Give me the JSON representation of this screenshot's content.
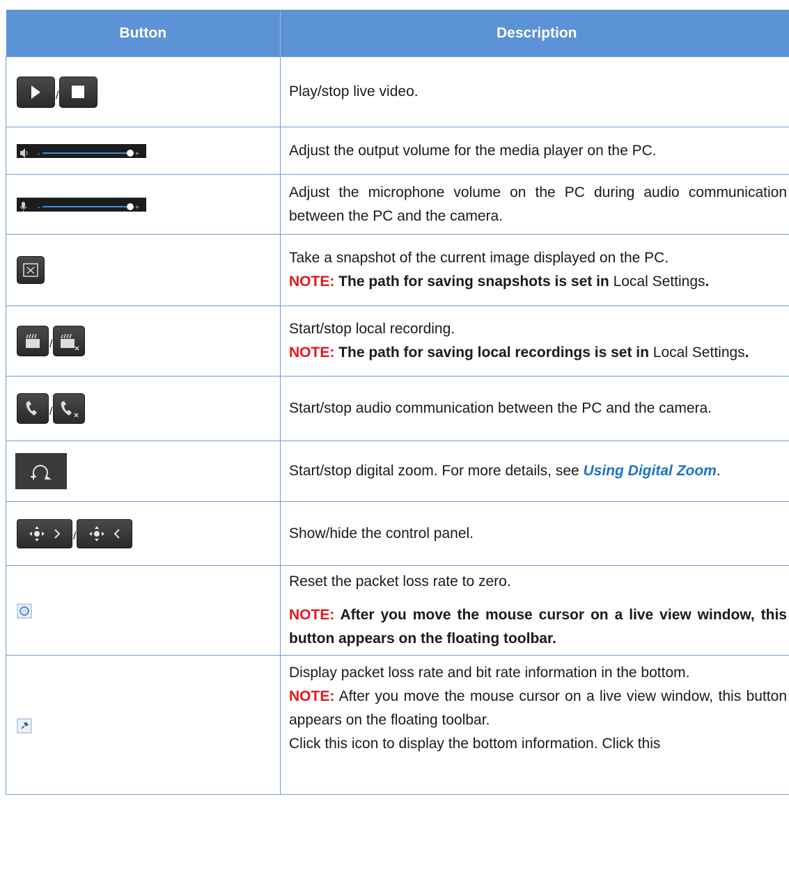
{
  "header": {
    "button": "Button",
    "description": "Description"
  },
  "rows": [
    {
      "sep": "/",
      "desc": "Play/stop live video."
    },
    {
      "desc": "Adjust the output volume for the media player on the PC."
    },
    {
      "desc": "Adjust the microphone volume on the PC during audio communication between the PC and the camera."
    },
    {
      "desc": "Take a snapshot of the current image displayed on the PC.",
      "note_label": "NOTE:",
      "note_bold": " The path for saving snapshots is set in ",
      "note_plain": "Local Settings",
      "note_end": "."
    },
    {
      "sep": "/",
      "desc": "Start/stop local recording.",
      "note_label": "NOTE:",
      "note_bold": " The path for saving local recordings is set in ",
      "note_plain": "Local Settings",
      "note_end": "."
    },
    {
      "sep": "/",
      "desc": "Start/stop audio communication between the PC and the camera."
    },
    {
      "desc": "Start/stop digital zoom. For more details, see ",
      "link": "Using Digital Zoom",
      "desc_end": "."
    },
    {
      "sep": "/",
      "desc": "Show/hide the control panel."
    },
    {
      "desc": "Reset the packet loss rate to zero.",
      "note_label": "NOTE:",
      "note_bold": " After you move the mouse cursor on a live view window, this button appears on the floating toolbar."
    },
    {
      "desc": "Display packet loss rate and bit rate information in the bottom.",
      "note_label": "NOTE:",
      "note_plain": " After you move the mouse cursor on a live view window, this button appears on the floating toolbar.",
      "desc2": "Click this icon to display the bottom information. Click this"
    }
  ]
}
